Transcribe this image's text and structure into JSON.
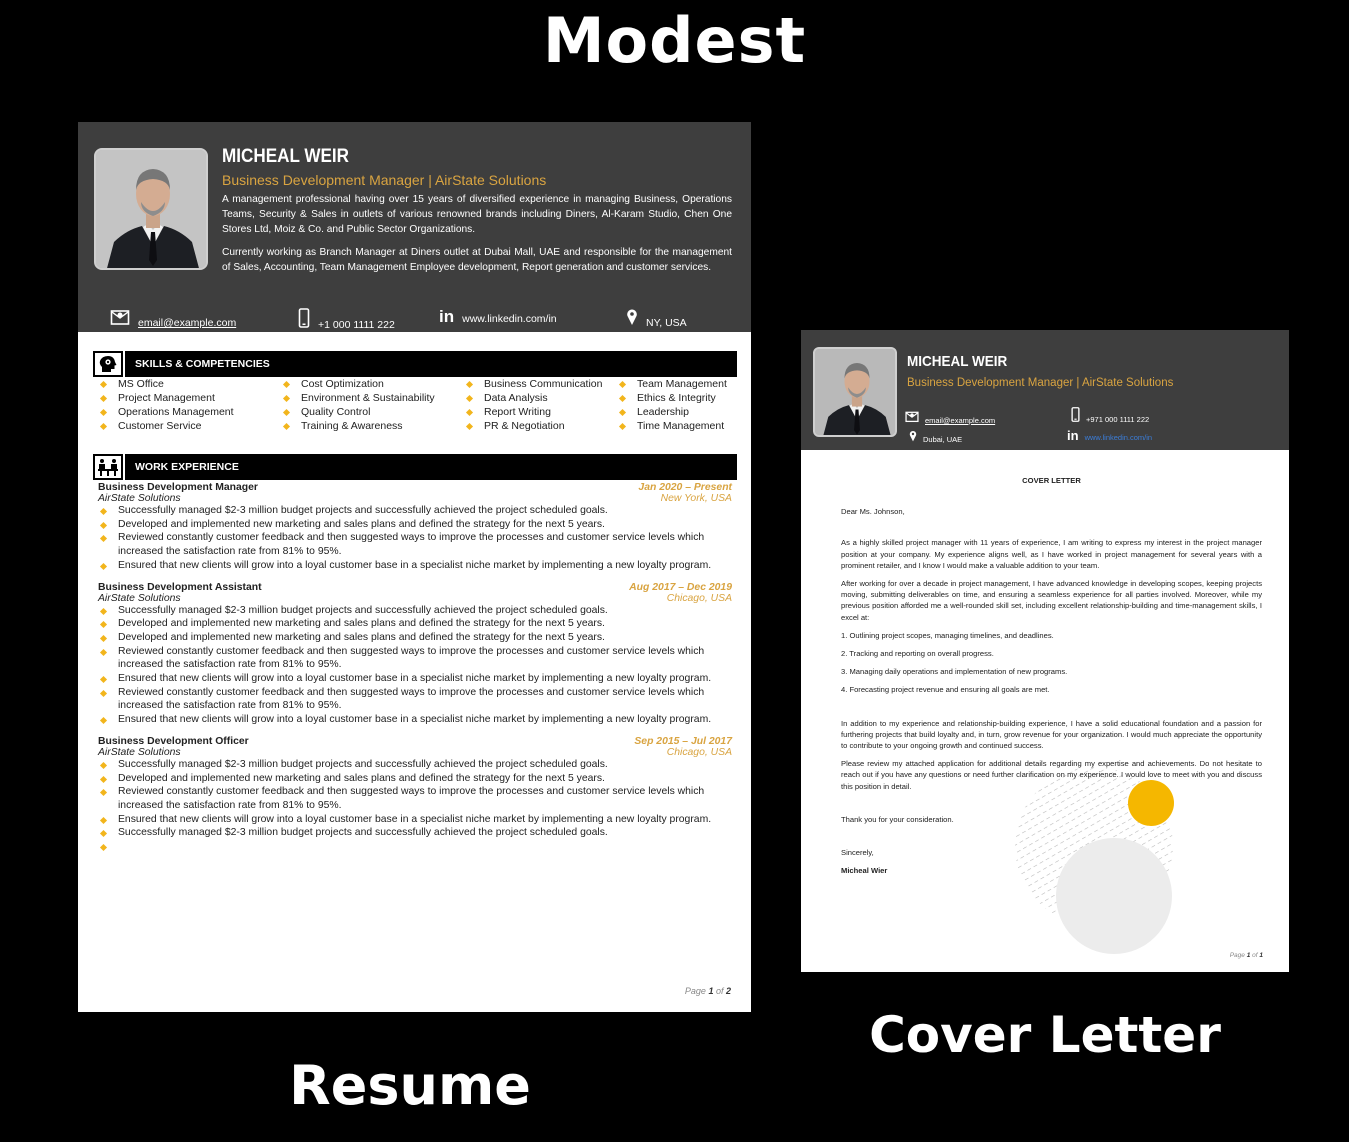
{
  "titles": {
    "modest": "Modest",
    "resume": "Resume",
    "cover_letter": "Cover Letter"
  },
  "colors": {
    "header_bg": "#3e3e3e",
    "accent": "#d9a441",
    "bullet": "#f2b51c",
    "section_bar": "#000000"
  },
  "resume": {
    "name": "MICHEAL WEIR",
    "role": "Business Development Manager | AirState Solutions",
    "summary_1": "A management professional having over 15 years of diversified experience in managing Business, Operations Teams, Security & Sales in outlets of various renowned brands including Diners, Al-Karam Studio, Chen One Stores Ltd, Moiz & Co. and Public Sector Organizations.",
    "summary_2": "Currently working as Branch Manager at Diners outlet at Dubai Mall, UAE and responsible for the management of Sales, Accounting, Team Management Employee development, Report generation and customer services.",
    "contact": {
      "email": "email@example.com",
      "phone": "+1 000 1111 222",
      "linkedin": "www.linkedin.com/in",
      "location": "NY, USA"
    },
    "skills_title": "SKILLS & COMPETENCIES",
    "skills": [
      [
        "MS Office",
        "Project Management",
        "Operations Management",
        "Customer Service"
      ],
      [
        "Cost Optimization",
        "Environment & Sustainability",
        "Quality Control",
        "Training & Awareness"
      ],
      [
        "Business Communication",
        "Data Analysis",
        "Report Writing",
        "PR & Negotiation"
      ],
      [
        "Team Management",
        "Ethics & Integrity",
        "Leadership",
        "Time Management"
      ]
    ],
    "work_title": "WORK EXPERIENCE",
    "jobs": [
      {
        "title": "Business Development Manager",
        "dates": "Jan 2020 – Present",
        "company": "AirState Solutions",
        "location": "New York, USA",
        "bullets": [
          "Successfully managed $2-3 million budget projects and successfully achieved the project scheduled goals.",
          "Developed and implemented new marketing and sales plans and defined the strategy for the next 5 years.",
          "Reviewed constantly customer feedback and then suggested ways to improve the processes and customer service levels which increased the satisfaction rate from 81% to 95%.",
          "Ensured that new clients will grow into a loyal customer base in a specialist niche market by implementing a new loyalty program."
        ]
      },
      {
        "title": "Business Development Assistant",
        "dates": "Aug 2017 – Dec 2019",
        "company": "AirState Solutions",
        "location": "Chicago, USA",
        "bullets": [
          "Successfully managed $2-3 million budget projects and successfully achieved the project scheduled goals.",
          "Developed and implemented new marketing and sales plans and defined the strategy for the next 5 years.",
          "Developed and implemented new marketing and sales plans and defined the strategy for the next 5 years.",
          "Reviewed constantly customer feedback and then suggested ways to improve the processes and customer service levels which increased the satisfaction rate from 81% to 95%.",
          "Ensured that new clients will grow into a loyal customer base in a specialist niche market by implementing a new loyalty program.",
          "Reviewed constantly customer feedback and then suggested ways to improve the processes and customer service levels which increased the satisfaction rate from 81% to 95%.",
          "Ensured that new clients will grow into a loyal customer base in a specialist niche market by implementing a new loyalty program."
        ]
      },
      {
        "title": "Business Development Officer",
        "dates": "Sep 2015 – Jul 2017",
        "company": "AirState Solutions",
        "location": "Chicago, USA",
        "bullets": [
          "Successfully managed $2-3 million budget projects and successfully achieved the project scheduled goals.",
          "Developed and implemented new marketing and sales plans and defined the strategy for the next 5 years.",
          "Reviewed constantly customer feedback and then suggested ways to improve the processes and customer service levels which increased the satisfaction rate from 81% to 95%.",
          "Ensured that new clients will grow into a loyal customer base in a specialist niche market by implementing a new loyalty program.",
          "Successfully managed $2-3 million budget projects and successfully achieved the project scheduled goals.",
          ""
        ]
      }
    ],
    "pager": {
      "prefix": "Page ",
      "current": "1",
      "of": " of ",
      "total": "2"
    }
  },
  "cover": {
    "name": "MICHEAL WEIR",
    "role": "Business Development Manager | AirState Solutions",
    "contact": {
      "email": "email@example.com",
      "phone": "+971 000 1111 222",
      "location": "Dubai, UAE",
      "linkedin": "www.linkedin.com/in"
    },
    "title": "COVER LETTER",
    "salutation": "Dear Ms. Johnson,",
    "p1": "As a highly skilled project manager with 11 years of experience, I am writing to express my interest in the project manager position at your company. My experience aligns well, as I have worked in project management for several years with a prominent retailer, and I know I would make a valuable addition to your team.",
    "p2": "After working for over a decade in project management, I have advanced knowledge in developing scopes, keeping projects moving, submitting deliverables on time, and ensuring a seamless experience for all parties involved. Moreover, while my previous position afforded me a well-rounded skill set, including excellent relationship-building and time-management skills, I excel at:",
    "list": [
      "1. Outlining project scopes, managing timelines, and deadlines.",
      "2. Tracking and reporting on overall progress.",
      "3. Managing daily operations and implementation of new programs.",
      "4. Forecasting project revenue and ensuring all goals are met."
    ],
    "p3": "In addition to my experience and relationship-building experience, I have a solid educational foundation and a passion for furthering projects that build loyalty and, in turn, grow revenue for your organization. I would much appreciate the opportunity to contribute to your ongoing growth and continued success.",
    "p4": "Please review my attached application for additional details regarding my expertise and achievements. Do not hesitate to reach out if you have any questions or need further clarification on my experience. I would love to meet with you and discuss this position in detail.",
    "thanks": "Thank you for your consideration.",
    "closing": "Sincerely,",
    "signature": "Micheal Wier",
    "pager": {
      "prefix": "Page ",
      "current": "1",
      "of": " of ",
      "total": "1"
    }
  }
}
